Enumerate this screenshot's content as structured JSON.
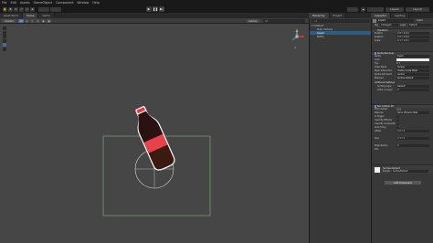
{
  "menu": [
    "File",
    "Edit",
    "Assets",
    "GameObject",
    "Component",
    "Window",
    "Help"
  ],
  "toolbar": {
    "account_label": "",
    "layers_label": "Layers",
    "layout_label": "Layout"
  },
  "scene_tabs": [
    "Scene",
    "Game",
    "Asset Store"
  ],
  "scene_toolbar": {
    "shading": "Shaded",
    "mode_2d": "2D",
    "gizmos": "Gizmos",
    "search": "All"
  },
  "hierarchy": {
    "tabs": [
      "Hierarchy",
      "Project"
    ],
    "search_placeholder": "All",
    "rows": [
      {
        "label": "▾ Untitled*",
        "selected": false
      },
      {
        "label": "Main Camera",
        "selected": false
      },
      {
        "label": "Liquid",
        "selected": true
      },
      {
        "label": "Bottle",
        "selected": false
      }
    ]
  },
  "inspector": {
    "tabs": [
      "Inspector",
      "Lighting"
    ],
    "object_name": "Liquid",
    "static_label": "Static",
    "tag_label": "Tag",
    "tag_value": "Untagged",
    "layer_label": "Layer",
    "layer_value": "Default",
    "transform": {
      "title": "Transform",
      "rows": [
        {
          "label": "Position",
          "value": "X 0   Y 0   Z 0"
        },
        {
          "label": "Rotation",
          "value": "X 0   Y 0   Z 0"
        },
        {
          "label": "Scale",
          "value": "X 1   Y 1   Z 1"
        }
      ]
    },
    "sprite_renderer": {
      "title": "Sprite Renderer",
      "rows": [
        {
          "label": "Sprite",
          "value": "liquid"
        },
        {
          "label": "Color",
          "value": ""
        },
        {
          "label": "Flip",
          "value": "X   Y"
        },
        {
          "label": "Draw Mode",
          "value": "Simple"
        },
        {
          "label": "Mask Interaction",
          "value": "Visible Inside Mask"
        },
        {
          "label": "Sprite Sort Point",
          "value": "Center"
        },
        {
          "label": "Material",
          "value": "Sprites-Default"
        }
      ],
      "additional": "Additional Settings",
      "sorting_layer_label": "Sorting Layer",
      "sorting_layer_value": "Default",
      "order_label": "Order in Layer",
      "order_value": "0"
    },
    "box_collider": {
      "title": "Box Collider 2D",
      "rows": [
        {
          "label": "Edit Collider",
          "value": ""
        },
        {
          "label": "Material",
          "value": "None (Physics Mat)"
        },
        {
          "label": "Is Trigger",
          "value": ""
        },
        {
          "label": "Used By Effector",
          "value": ""
        },
        {
          "label": "Used By Composite",
          "value": ""
        },
        {
          "label": "Auto Tiling",
          "value": ""
        },
        {
          "label": "Offset",
          "value": "X 0   Y 0"
        },
        {
          "label": "Size",
          "value": "X 1   Y 1"
        },
        {
          "label": "Edge Radius",
          "value": "0"
        },
        {
          "label": "Info",
          "value": ""
        }
      ]
    },
    "material": {
      "name": "Sprites-Default",
      "shader_label": "Shader",
      "shader_value": "Sprites/Default"
    },
    "add_component": "Add Component"
  },
  "colors": {
    "scene_bg": "#464646",
    "panel_bg": "#383838",
    "selection": "#2c5d87",
    "bottle_red": "#e8414a",
    "bottle_cap": "#e83a46",
    "liquid_dark": "#3a1c10",
    "collider_green": "#7fd67f"
  }
}
